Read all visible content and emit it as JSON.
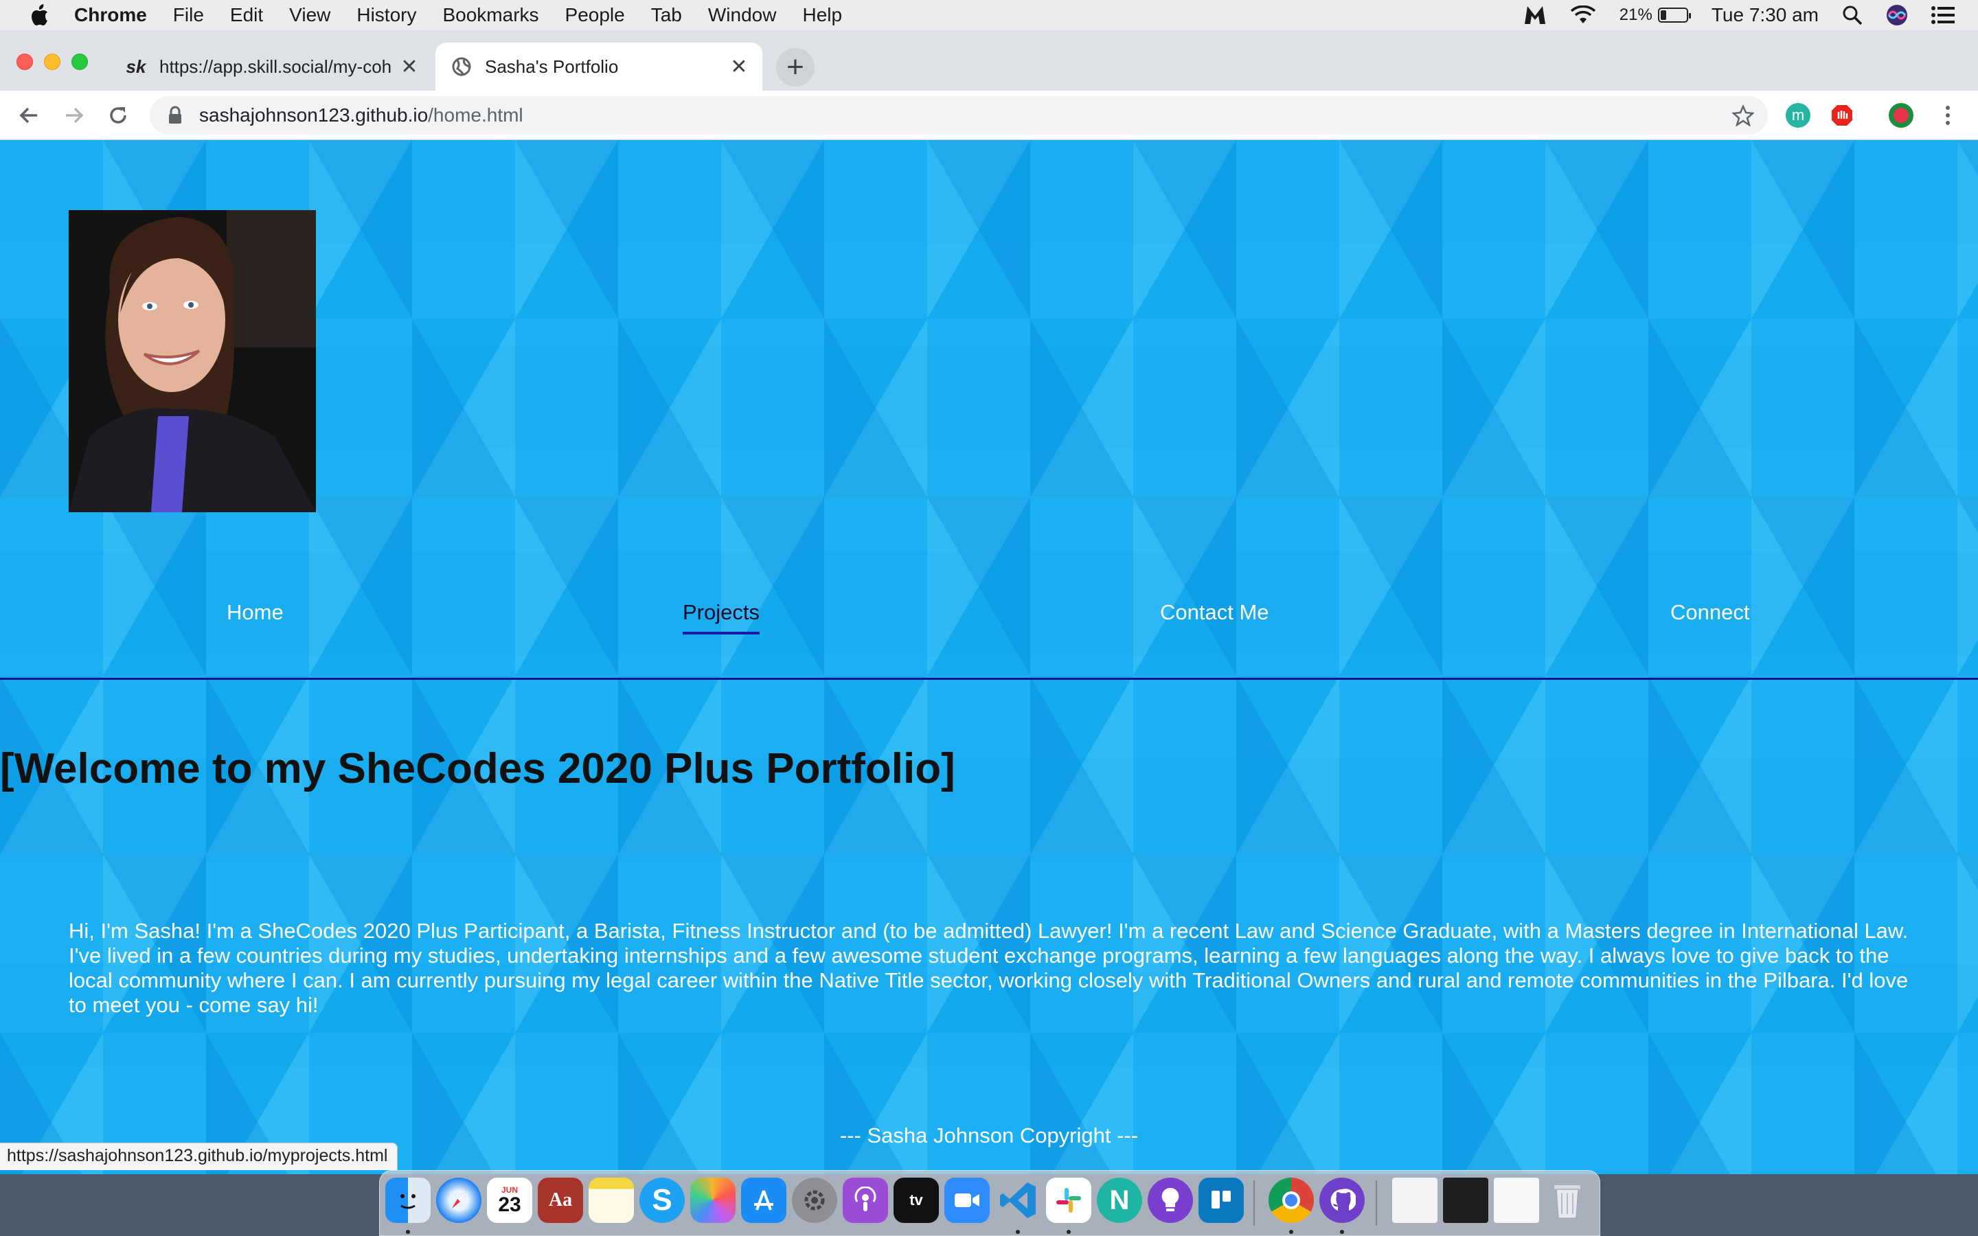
{
  "menubar": {
    "app": "Chrome",
    "items": [
      "File",
      "Edit",
      "View",
      "History",
      "Bookmarks",
      "People",
      "Tab",
      "Window",
      "Help"
    ],
    "battery": "21%",
    "clock": "Tue 7:30 am",
    "icons": [
      "apple-icon",
      "malwarebytes-icon",
      "wifi-icon",
      "battery-icon",
      "spotlight-search-icon",
      "siri-icon",
      "control-menu-icon"
    ]
  },
  "tabs": [
    {
      "title": "https://app.skill.social/my-coh",
      "favicon": "sk",
      "active": false
    },
    {
      "title": "Sasha's Portfolio",
      "favicon": "globe-icon",
      "active": true
    }
  ],
  "toolbar": {
    "url_host": "sashajohnson123.github.io",
    "url_path": "/home.html"
  },
  "page": {
    "nav": {
      "home": "Home",
      "projects": "Projects",
      "contact": "Contact Me",
      "connect": "Connect",
      "active": "Projects"
    },
    "heading": "[Welcome to my SheCodes 2020 Plus Portfolio]",
    "bio": "Hi, I'm Sasha! I'm a SheCodes 2020 Plus Participant, a Barista, Fitness Instructor and (to be admitted) Lawyer! I'm a recent Law and Science Graduate, with a Masters degree in International Law. I've lived in a few countries during my studies, undertaking internships and a few awesome student exchange programs, learning a few languages along the way. I always love to give back to the local community where I can. I am currently pursuing my legal career within the Native Title sector, working closely with Traditional Owners and rural and remote communities in the Pilbara. I'd love to meet you - come say hi!",
    "footer": "--- Sasha Johnson Copyright ---",
    "background_color": "#1aaef0"
  },
  "status_url": "https://sashajohnson123.github.io/myprojects.html",
  "dock": {
    "calendar_month": "JUN",
    "calendar_day": "23",
    "apps": [
      "finder",
      "safari",
      "calendar",
      "dictionary",
      "notes",
      "skype",
      "photos",
      "app-store",
      "system-preferences",
      "podcasts",
      "apple-tv",
      "zoom",
      "vscode",
      "slack",
      "notion",
      "brave-tip",
      "trello",
      "chrome",
      "github-desktop",
      "window-chrome",
      "window-terminal",
      "window-github",
      "trash"
    ]
  }
}
